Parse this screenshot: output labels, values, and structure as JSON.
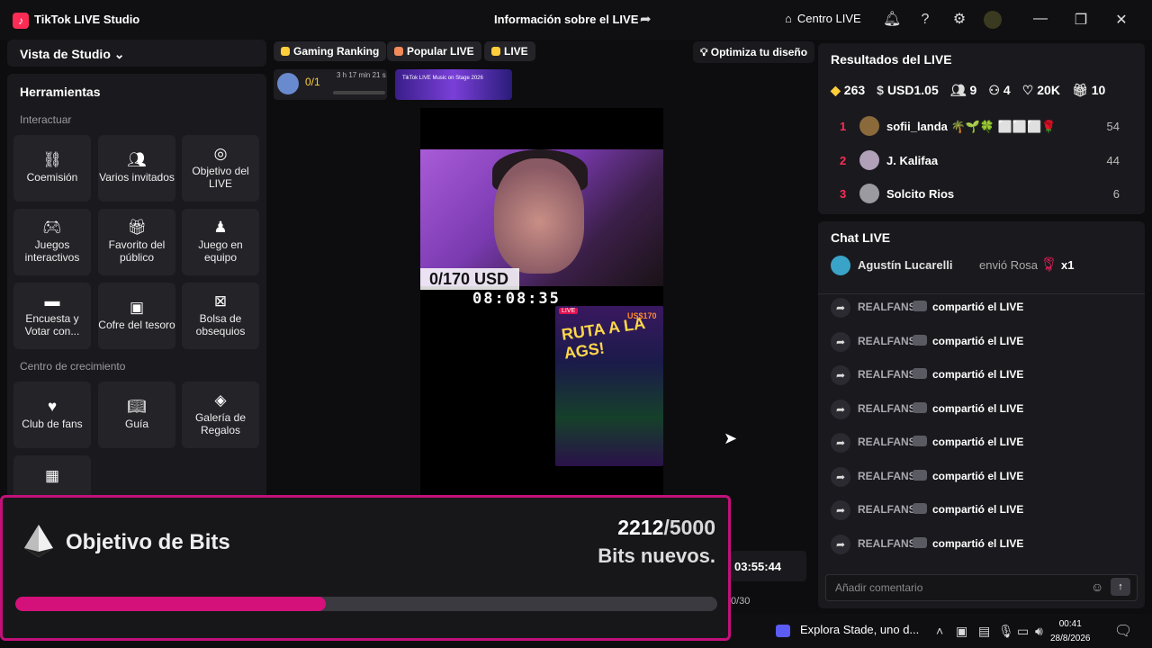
{
  "titlebar": {
    "app_title": "TikTok LIVE Studio",
    "live_info": "Información sobre el LIVE",
    "centro": "Centro LIVE"
  },
  "left": {
    "studio_view": "Vista de Studio",
    "tools_title": "Herramientas",
    "section_interact": "Interactuar",
    "section_growth": "Centro de crecimiento",
    "tools": [
      {
        "label": "Coemisión",
        "icon": "link-icon"
      },
      {
        "label": "Varios invitados",
        "icon": "people-icon"
      },
      {
        "label": "Objetivo del LIVE",
        "icon": "target-icon"
      },
      {
        "label": "Juegos interactivos",
        "icon": "gamepad-icon"
      },
      {
        "label": "Favorito del público",
        "icon": "gift-icon"
      },
      {
        "label": "Juego en equipo",
        "icon": "team-icon"
      },
      {
        "label": "Encuesta y Votar con...",
        "icon": "poll-icon"
      },
      {
        "label": "Cofre del tesoro",
        "icon": "chest-icon"
      },
      {
        "label": "Bolsa de obsequios",
        "icon": "bag-icon"
      }
    ],
    "growth_tools": [
      {
        "label": "Club de fans",
        "icon": "heart-icon"
      },
      {
        "label": "Guía",
        "icon": "book-icon"
      },
      {
        "label": "Galería de Regalos",
        "icon": "gem-icon"
      }
    ]
  },
  "center": {
    "chips": [
      "Gaming Ranking",
      "Popular LIVE",
      "LIVE"
    ],
    "optimize": "Optimiza tu diseño",
    "rank_count": "0/1",
    "rank_time": "3 h 17 min 21 s",
    "promo_text": "TikTok LIVE Music on Stage 2026",
    "usd_goal": "0/170 USD",
    "stream_clock": "08:08:35",
    "poster_title": "RUTA A LA AGS!",
    "poster_price": "US$170",
    "poster_live": "LIVE",
    "stream_time": "03:55:44",
    "count_30": "0/30"
  },
  "bits": {
    "title": "Objetivo de Bits",
    "current": "2212",
    "goal": "/5000",
    "subtitle": "Bits nuevos.",
    "progress_fraction": 0.4424
  },
  "results": {
    "title": "Resultados del LIVE",
    "stats": [
      {
        "icon": "diamond-icon",
        "value": "263"
      },
      {
        "icon": "dollar-icon",
        "value": "USD1.05"
      },
      {
        "icon": "viewers-icon",
        "value": "9"
      },
      {
        "icon": "follow-icon",
        "value": "4"
      },
      {
        "icon": "heart-icon",
        "value": "20K"
      },
      {
        "icon": "gift-icon",
        "value": "10"
      }
    ],
    "gifters": [
      {
        "rank": "1",
        "name": "sofii_landa 🌴🌱🍀 ⬜⬜⬜🌹",
        "score": "54",
        "color": "#8a6a3a"
      },
      {
        "rank": "2",
        "name": "J. Kalifaa",
        "score": "44",
        "color": "#b0a0b8"
      },
      {
        "rank": "3",
        "name": "Solcito Rios",
        "score": "6",
        "color": "#9a9aa0"
      }
    ]
  },
  "chat": {
    "title": "Chat LIVE",
    "pinned_user": "Agustín Lucarelli",
    "pinned_action": "envió Rosa",
    "pinned_qty": "x1",
    "messages": [
      {
        "user": "REALFANS",
        "text": "compartió el LIVE"
      },
      {
        "user": "REALFANS",
        "text": "compartió el LIVE"
      },
      {
        "user": "REALFANS",
        "text": "compartió el LIVE"
      },
      {
        "user": "REALFANS",
        "text": "compartió el LIVE"
      },
      {
        "user": "REALFANS",
        "text": "compartió el LIVE"
      },
      {
        "user": "REALFANS",
        "text": "compartió el LIVE"
      },
      {
        "user": "REALFANS",
        "text": "compartió el LIVE"
      },
      {
        "user": "REALFANS",
        "text": "compartió el LIVE"
      }
    ],
    "comment_placeholder": "Añadir comentario"
  },
  "taskbar": {
    "search": "Explora Stade, uno d...",
    "time": "00:41",
    "date": "28/8/2026"
  }
}
